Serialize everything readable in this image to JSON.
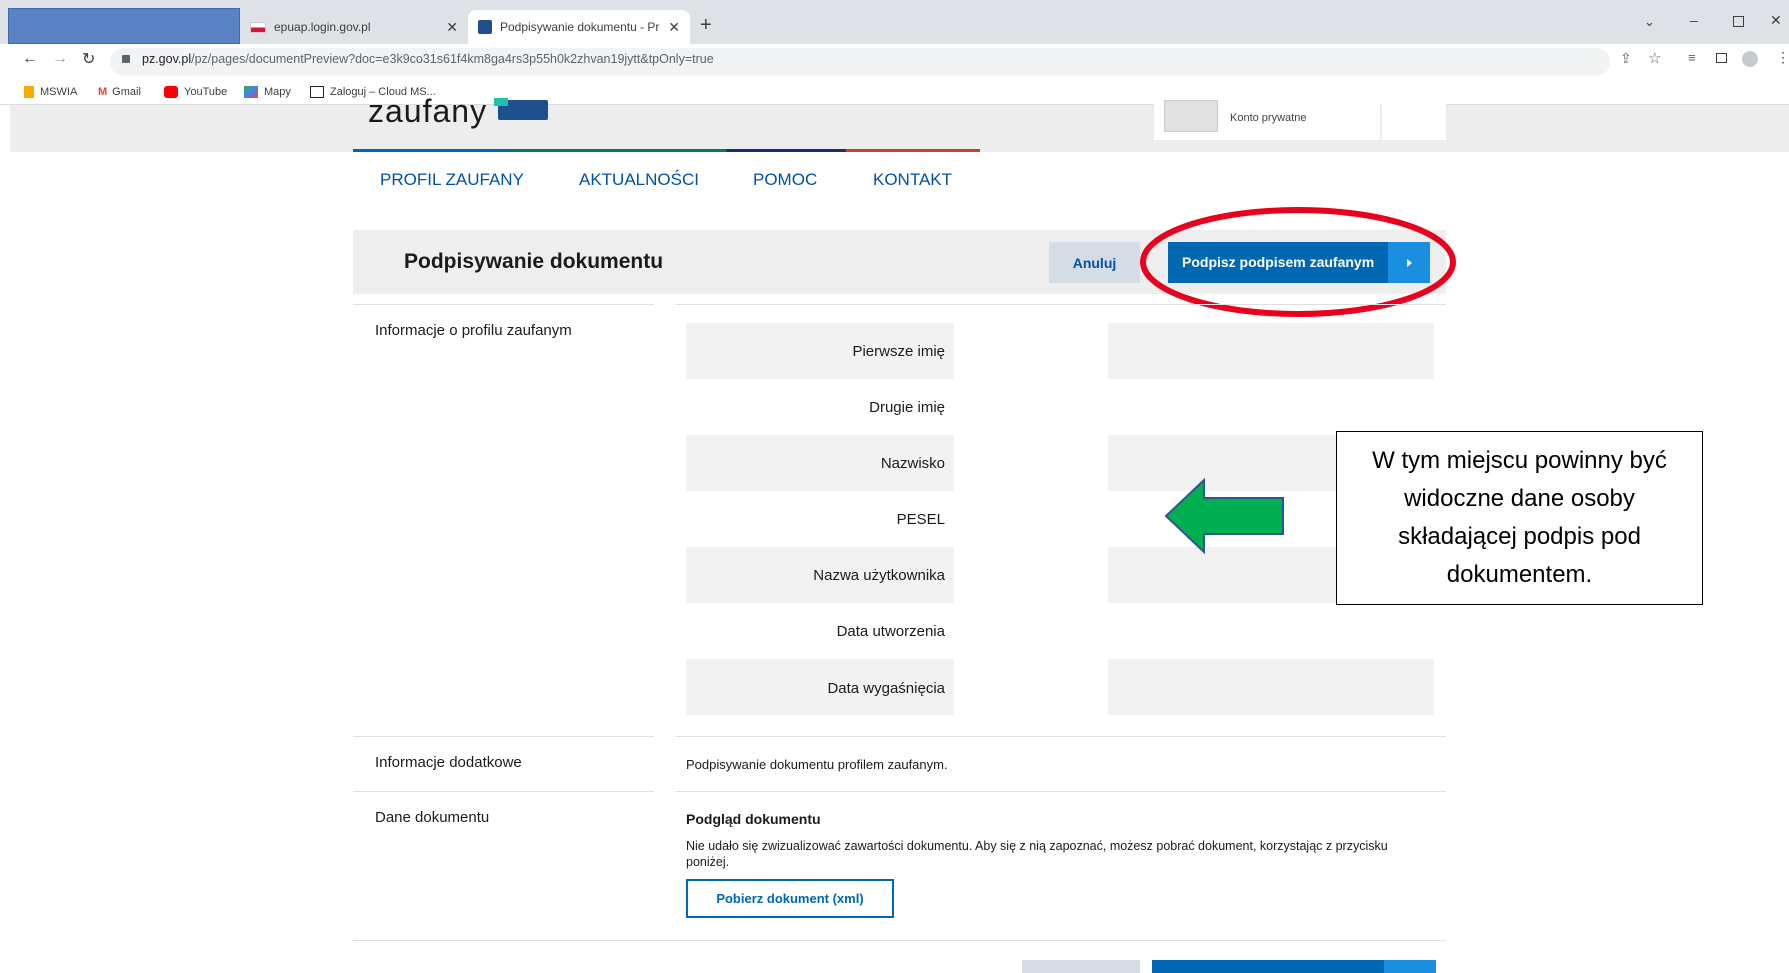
{
  "browser": {
    "tabs": [
      {
        "title": "epuap.login.gov.pl"
      },
      {
        "title": "Podpisywanie dokumentu - Profil"
      }
    ],
    "url_host": "pz.gov.pl",
    "url_path": "/pz/pages/documentPreview?doc=e3k9co31s61f4km8ga4rs3p55h0k2zhvan19jytt&tpOnly=true",
    "bookmarks": [
      "MSWIA",
      "Gmail",
      "YouTube",
      "Mapy",
      "Zaloguj – Cloud MS..."
    ]
  },
  "header": {
    "logo_text": "zaufany",
    "account_type": "Konto prywatne"
  },
  "nav": [
    "PROFIL ZAUFANY",
    "AKTUALNOŚCI",
    "POMOC",
    "KONTAKT"
  ],
  "page": {
    "title": "Podpisywanie dokumentu",
    "cancel_label": "Anuluj",
    "sign_label": "Podpisz podpisem zaufanym"
  },
  "profile": {
    "section_label": "Informacje o profilu zaufanym",
    "fields": [
      "Pierwsze imię",
      "Drugie imię",
      "Nazwisko",
      "PESEL",
      "Nazwa użytkownika",
      "Data utworzenia",
      "Data wygaśnięcia"
    ]
  },
  "additional": {
    "section_label": "Informacje dodatkowe",
    "text": "Podpisywanie dokumentu profilem zaufanym."
  },
  "document": {
    "section_label": "Dane dokumentu",
    "preview_title": "Podgląd dokumentu",
    "preview_text": "Nie udało się zwizualizować zawartości dokumentu. Aby się z nią zapoznać, możesz pobrać dokument, korzystając z przycisku poniżej.",
    "download_label": "Pobierz dokument (xml)"
  },
  "annotation": {
    "callout_text": "W tym miejscu powinny być widoczne dane osoby składającej podpis pod dokumentem."
  },
  "colors": {
    "primary": "#0067b2",
    "primary_dark": "#0052a5",
    "cancel_bg": "#d6dce5",
    "highlight": "#e8001c",
    "arrow": "#00b050"
  }
}
